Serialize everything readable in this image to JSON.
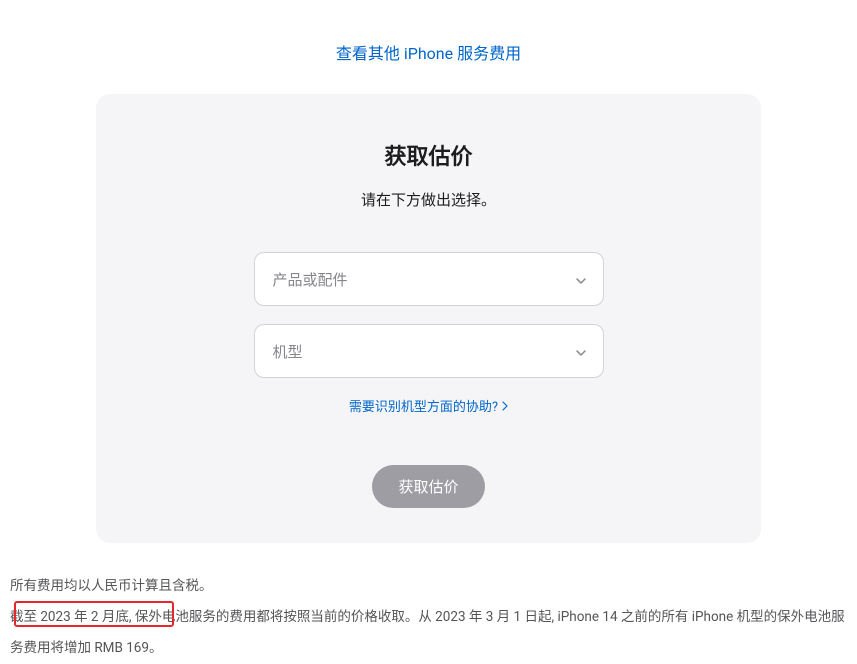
{
  "topLink": {
    "text": "查看其他 iPhone 服务费用"
  },
  "card": {
    "title": "获取估价",
    "subtitle": "请在下方做出选择。",
    "select1": {
      "placeholder": "产品或配件"
    },
    "select2": {
      "placeholder": "机型"
    },
    "helpLink": "需要识别机型方面的协助?",
    "submitLabel": "获取估价"
  },
  "footer": {
    "line1": "所有费用均以人民币计算且含税。",
    "line2": "截至 2023 年 2 月底, 保外电池服务的费用都将按照当前的价格收取。从 2023 年 3 月 1 日起, iPhone 14 之前的所有 iPhone 机型的保外电池服务费用将增加 RMB 169。"
  }
}
